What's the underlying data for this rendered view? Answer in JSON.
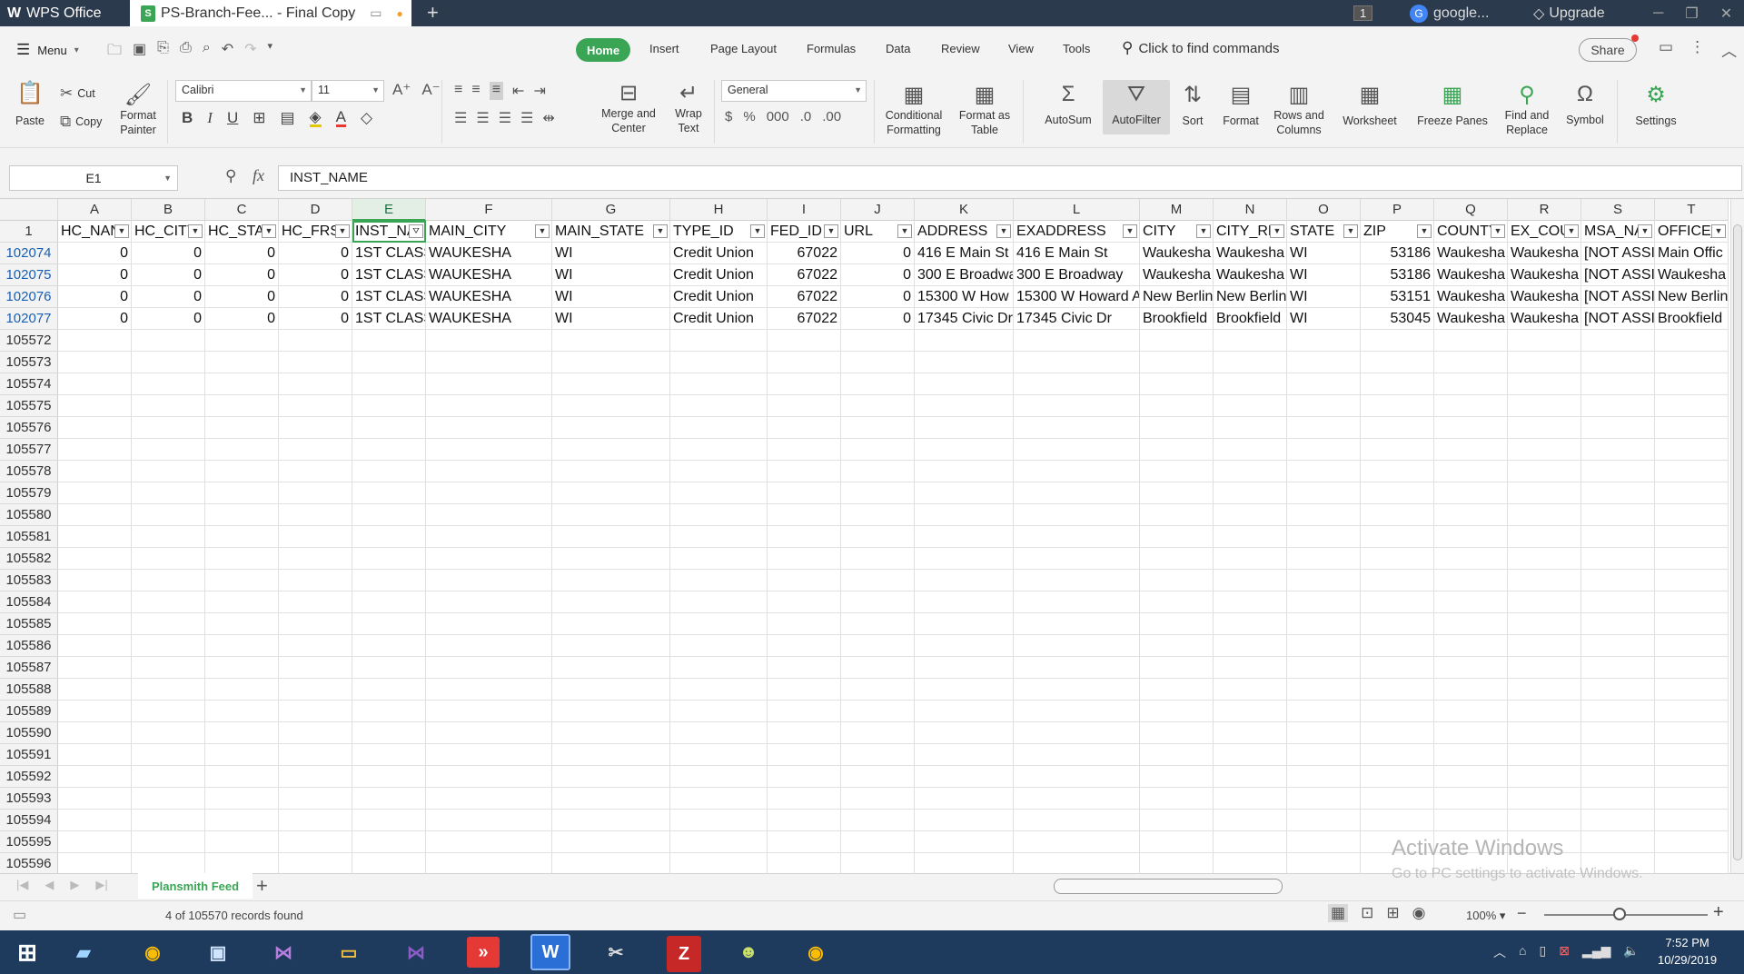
{
  "app": {
    "app_tab": "WPS Office",
    "doc_tab": "PS-Branch-Fee... - Final Copy",
    "badge": "1",
    "account": "google...",
    "upgrade": "Upgrade"
  },
  "menu": {
    "menu_label": "Menu",
    "tabs": [
      "Home",
      "Insert",
      "Page Layout",
      "Formulas",
      "Data",
      "Review",
      "View",
      "Tools"
    ],
    "search": "Click to find commands",
    "share": "Share"
  },
  "ribbon": {
    "paste": "Paste",
    "cut": "Cut",
    "copy": "Copy",
    "format_painter": [
      "Format",
      "Painter"
    ],
    "font_name": "Calibri",
    "font_size": "11",
    "merge_center": [
      "Merge and",
      "Center"
    ],
    "wrap_text": [
      "Wrap",
      "Text"
    ],
    "number_format": "General",
    "conditional": [
      "Conditional",
      "Formatting"
    ],
    "format_table": [
      "Format as",
      "Table"
    ],
    "autosum": "AutoSum",
    "autofilter": "AutoFilter",
    "sort": "Sort",
    "format": "Format",
    "rows_columns": [
      "Rows and",
      "Columns"
    ],
    "worksheet": "Worksheet",
    "freeze_panes": "Freeze Panes",
    "find_replace": [
      "Find and",
      "Replace"
    ],
    "symbol": "Symbol",
    "settings": "Settings"
  },
  "formula_bar": {
    "name_box": "E1",
    "fx": "fx",
    "content": "INST_NAME"
  },
  "sheet": {
    "columns": [
      "A",
      "B",
      "C",
      "D",
      "E",
      "F",
      "G",
      "H",
      "I",
      "J",
      "K",
      "L",
      "M",
      "N",
      "O",
      "P",
      "Q",
      "R",
      "S",
      "T"
    ],
    "header_row_num": "1",
    "headers": [
      "HC_NAN",
      "HC_CITY",
      "HC_STA",
      "HC_FRS",
      "INST_NA",
      "MAIN_CITY",
      "MAIN_STATE",
      "TYPE_ID",
      "FED_ID",
      "URL",
      "ADDRESS",
      "EXADDRESS",
      "CITY",
      "CITY_RE",
      "STATE",
      "ZIP",
      "COUNTY",
      "EX_COU",
      "MSA_NA",
      "OFFICE_"
    ],
    "data_rows": [
      {
        "num": "102074",
        "cells": [
          "0",
          "0",
          "0",
          "0",
          "1ST CLASS",
          "WAUKESHA",
          "WI",
          "Credit Union",
          "67022",
          "0",
          "416 E Main St",
          "416 E Main St",
          "Waukesha",
          "Waukesha",
          "WI",
          "53186",
          "Waukesha",
          "Waukesha",
          "[NOT ASSI",
          "Main Offic"
        ]
      },
      {
        "num": "102075",
        "cells": [
          "0",
          "0",
          "0",
          "0",
          "1ST CLASS",
          "WAUKESHA",
          "WI",
          "Credit Union",
          "67022",
          "0",
          "300 E Broadwa",
          "300 E Broadway",
          "Waukesha",
          "Waukesha",
          "WI",
          "53186",
          "Waukesha",
          "Waukesha",
          "[NOT ASSI",
          "Waukesha"
        ]
      },
      {
        "num": "102076",
        "cells": [
          "0",
          "0",
          "0",
          "0",
          "1ST CLASS",
          "WAUKESHA",
          "WI",
          "Credit Union",
          "67022",
          "0",
          "15300 W How",
          "15300 W Howard A",
          "New Berlin",
          "New Berlin",
          "WI",
          "53151",
          "Waukesha",
          "Waukesha",
          "[NOT ASSI",
          "New Berlin"
        ]
      },
      {
        "num": "102077",
        "cells": [
          "0",
          "0",
          "0",
          "0",
          "1ST CLASS",
          "WAUKESHA",
          "WI",
          "Credit Union",
          "67022",
          "0",
          "17345 Civic Dr",
          "17345 Civic Dr",
          "Brookfield",
          "Brookfield",
          "WI",
          "53045",
          "Waukesha",
          "Waukesha",
          "[NOT ASSI",
          "Brookfield"
        ]
      }
    ],
    "empty_rows": [
      "105572",
      "105573",
      "105574",
      "105575",
      "105576",
      "105577",
      "105578",
      "105579",
      "105580",
      "105581",
      "105582",
      "105583",
      "105584",
      "105585",
      "105586",
      "105587",
      "105588",
      "105589",
      "105590",
      "105591",
      "105592",
      "105593",
      "105594",
      "105595",
      "105596"
    ],
    "sheet_tab": "Plansmith Feed"
  },
  "status": {
    "records": "4 of 105570 records found",
    "zoom": "100%"
  },
  "watermark": {
    "line1": "Activate Windows",
    "line2": "Go to PC settings to activate Windows."
  },
  "clock": {
    "time": "7:52 PM",
    "date": "10/29/2019"
  },
  "colors": {
    "accent": "#3aa655",
    "titlebar": "#2b3a4d",
    "taskbar": "#1e3a5c",
    "row_link": "#1a5fb4"
  },
  "icons": [
    "menu-icon",
    "open-icon",
    "save-icon",
    "print-icon",
    "undo-icon",
    "redo-icon",
    "search-icon",
    "cut-icon",
    "copy-icon",
    "paste-icon",
    "bold-icon",
    "italic-icon",
    "underline-icon",
    "borders-icon",
    "fill-color-icon",
    "font-color-icon",
    "clear-icon",
    "autosum-icon",
    "filter-icon",
    "sort-icon",
    "find-icon",
    "symbol-icon",
    "settings-icon",
    "filter-dropdown-icon"
  ]
}
